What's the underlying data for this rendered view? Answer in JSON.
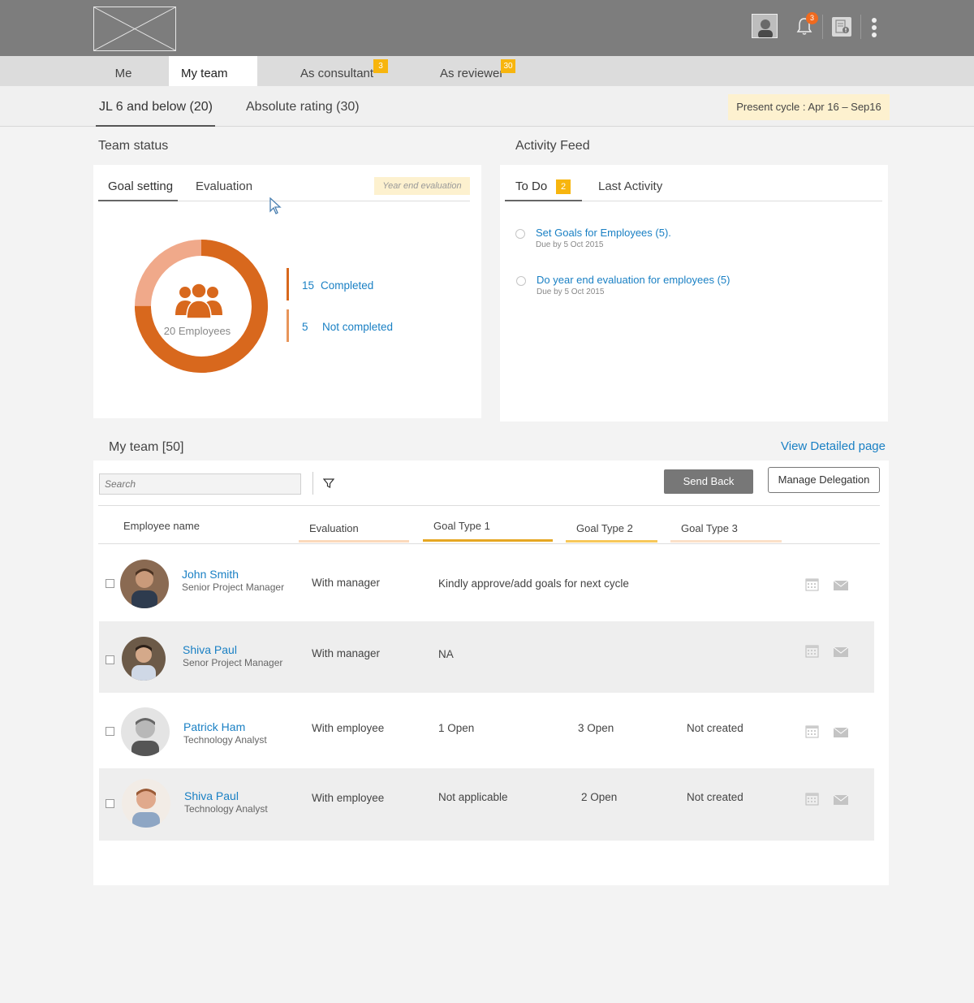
{
  "header": {
    "notifications_count": "3"
  },
  "tabs": [
    {
      "label": "Me",
      "badge": ""
    },
    {
      "label": "My team",
      "badge": ""
    },
    {
      "label": "As consultant",
      "badge": "3"
    },
    {
      "label": "As reviewer",
      "badge": "30"
    }
  ],
  "subtabs": [
    "JL 6 and below (20)",
    "Absolute rating (30)"
  ],
  "cycle": "Present cycle : Apr 16 – Sep16",
  "team_status": {
    "title": "Team status",
    "tabs": [
      "Goal setting",
      "Evaluation"
    ],
    "chip": "Year end evaluation",
    "center_label": "20 Employees",
    "completed": {
      "count": "15",
      "label": "Completed"
    },
    "not_completed": {
      "count": "5",
      "label": "Not completed"
    },
    "completed_fraction": 0.75,
    "colors": {
      "completed": "#d8681d",
      "not_completed": "#f0a98a"
    }
  },
  "activity": {
    "title": "Activity Feed",
    "tabs": [
      "To Do",
      "Last Activity"
    ],
    "todo_badge": "2",
    "items": [
      {
        "title": "Set Goals for Employees (5).",
        "due": "Due by 5 Oct 2015"
      },
      {
        "title": "Do year end evaluation for employees (5)",
        "due": "Due by 5 Oct 2015"
      }
    ]
  },
  "my_team": {
    "title": "My team [50]",
    "view_link": "View Detailed page",
    "search_placeholder": "Search",
    "send_back": "Send Back",
    "manage_delegation": "Manage Delegation",
    "columns": [
      "Employee name",
      "Evaluation",
      "Goal Type 1",
      "Goal Type 2",
      "Goal Type 3"
    ],
    "rows": [
      {
        "name": "John Smith",
        "role": "Senior Project Manager",
        "evaluation": "With manager",
        "goal1": "Kindly approve/add goals for next cycle",
        "goal2": "",
        "goal3": ""
      },
      {
        "name": "Shiva Paul",
        "role": "Senor Project Manager",
        "evaluation": "With manager",
        "goal1": "NA",
        "goal2": "",
        "goal3": ""
      },
      {
        "name": "Patrick Ham",
        "role": "Technology Analyst",
        "evaluation": "With employee",
        "goal1": "1 Open",
        "goal2": "3 Open",
        "goal3": "Not created"
      },
      {
        "name": "Shiva Paul",
        "role": "Technology Analyst",
        "evaluation": "With employee",
        "goal1": "Not applicable",
        "goal2": "2 Open",
        "goal3": "Not created"
      }
    ]
  },
  "colors": {
    "accent_blue": "#1a80c4",
    "badge_yellow": "#f7b50e",
    "topbar": "#7d7d7d"
  }
}
